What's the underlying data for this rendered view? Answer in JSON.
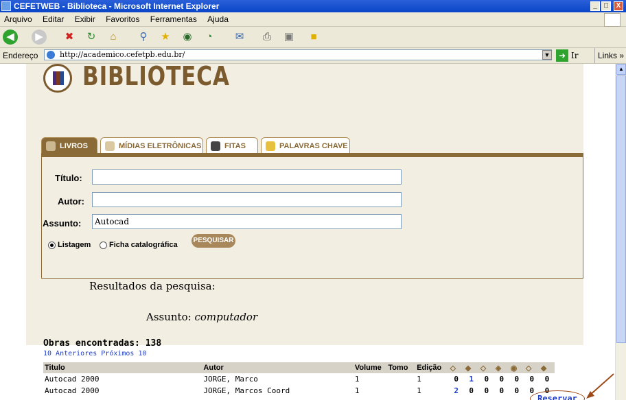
{
  "window": {
    "title": "CEFETWEB - Biblioteca - Microsoft Internet Explorer",
    "controls": [
      "_",
      "□",
      "X"
    ]
  },
  "menubar": {
    "items": [
      "Arquivo",
      "Editar",
      "Exibir",
      "Favoritos",
      "Ferramentas",
      "Ajuda"
    ]
  },
  "address": {
    "label": "Endereço",
    "url": "http://academico.cefetpb.edu.br/",
    "go_label": "Ir",
    "links_label": "Links »"
  },
  "page": {
    "brand": "BIBLIOTECA",
    "tabs": [
      {
        "label": "LIVROS",
        "active": true
      },
      {
        "label": "MÍDIAS ELETRÔNICAS",
        "active": false
      },
      {
        "label": "FITAS",
        "active": false
      },
      {
        "label": "PALAVRAS CHAVE",
        "active": false
      }
    ],
    "form": {
      "title_label": "Título:",
      "title_value": "",
      "author_label": "Autor:",
      "author_value": "",
      "subject_label": "Assunto:",
      "subject_value": "Autocad",
      "radio_list": "Listagem",
      "radio_card": "Ficha catalográfica",
      "search_button": "PESQUISAR"
    },
    "results_heading": "Resultados da pesquisa:",
    "subject_prefix": "Assunto: ",
    "subject_term": "computador",
    "found": "Obras encontradas: 138",
    "nav": "10 Anteriores Próximos 10",
    "table": {
      "headers": [
        "Titulo",
        "Autor",
        "Volume",
        "Tomo",
        "Edição"
      ],
      "rows": [
        {
          "titulo": "Autocad 2000",
          "autor": "JORGE, Marco",
          "volume": "1",
          "tomo": "",
          "edicao": "1",
          "counts": [
            "0",
            "1",
            "0",
            "0",
            "0",
            "0",
            "0"
          ]
        },
        {
          "titulo": "Autocad 2000",
          "autor": "JORGE, Marcos Coord",
          "volume": "1",
          "tomo": "",
          "edicao": "1",
          "counts": [
            "2",
            "0",
            "0",
            "0",
            "0",
            "0",
            "0"
          ]
        }
      ],
      "reserve_label": "Reservar"
    }
  },
  "colors": {
    "brand": "#7b5b2d",
    "panel_bg": "#f2eee2",
    "link_blue": "#1e3cc8",
    "title_bar": "#0a46c8"
  }
}
